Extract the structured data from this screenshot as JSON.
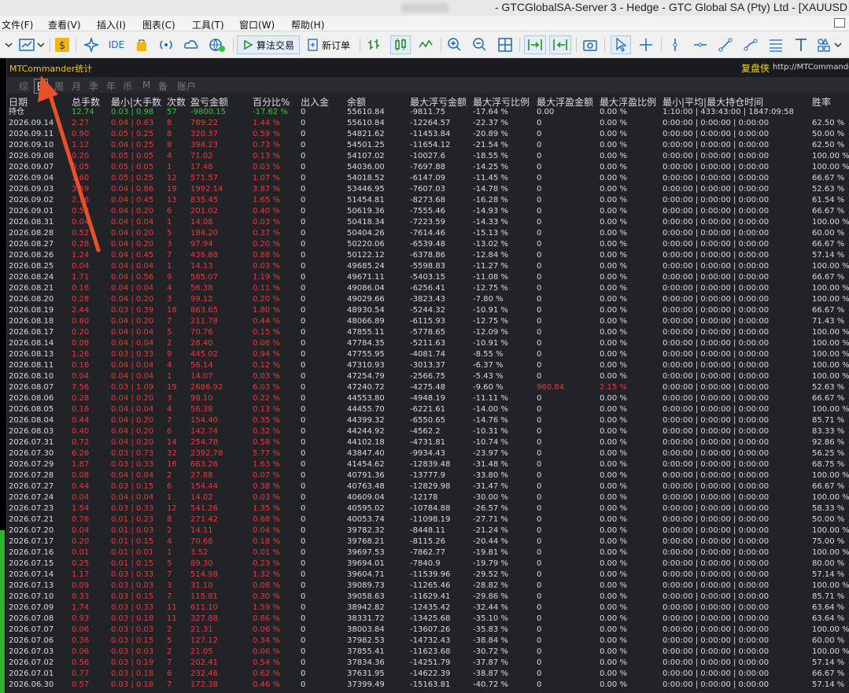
{
  "window": {
    "title": "- GTCGlobalSA-Server 3 - Hedge - GTC Global SA (Pty) Ltd - [XAUUSD"
  },
  "menu": [
    "文件(F)",
    "查看(V)",
    "插入(I)",
    "图表(C)",
    "工具(T)",
    "窗口(W)",
    "帮助(H)"
  ],
  "toolbar": {
    "ide": "IDE",
    "algo": "算法交易",
    "new_order": "新订单"
  },
  "panel": {
    "name": "MTCommander统计",
    "brand": "复盘侠",
    "url": "http://MTCommander"
  },
  "tabs": [
    "综",
    "日",
    "周",
    "月",
    "季",
    "年",
    "币",
    "M",
    "备",
    "账户"
  ],
  "active_tab": "日",
  "columns": [
    "日期",
    "总手数",
    "最小|大手数",
    "次数",
    "盈亏金额",
    "百分比%",
    "出入金",
    "余额",
    "最大浮亏金额",
    "最大浮亏比例",
    "最大浮盈金额",
    "最大浮盈比例",
    "最小|平均|最大持仓时间",
    "胜率"
  ],
  "positions_row": [
    "持仓",
    "12.74",
    "0.03 | 0.98",
    "57",
    "-9800.15",
    "-17.62 %",
    "0",
    "55610.84",
    "-9811.75",
    "-17.64 %",
    "0.00",
    "0.00 %",
    "1:10:00 | 433:43:00 | 1847:09:58",
    ""
  ],
  "rows": [
    [
      "2026.09.14",
      "2.27",
      "0.04 | 0.63",
      "8",
      "789.22",
      "1.44 %",
      "0",
      "55610.84",
      "-12264.57",
      "-22.37 %",
      "0",
      "0.00 %",
      "0:00:00 | 0:00:00 | 0:00:00",
      "62.50 %"
    ],
    [
      "2026.09.11",
      "0.90",
      "0.05 | 0.25",
      "8",
      "320.37",
      "0.59 %",
      "0",
      "54821.62",
      "-11453.84",
      "-20.89 %",
      "0",
      "0.00 %",
      "0:00:00 | 0:00:00 | 0:00:00",
      "50.00 %"
    ],
    [
      "2026.09.10",
      "1.12",
      "0.04 | 0.25",
      "8",
      "394.23",
      "0.73 %",
      "0",
      "54501.25",
      "-11654.12",
      "-21.54 %",
      "0",
      "0.00 %",
      "0:00:00 | 0:00:00 | 0:00:00",
      "62.50 %"
    ],
    [
      "2026.09.08",
      "0.20",
      "0.05 | 0.05",
      "4",
      "71.02",
      "0.13 %",
      "0",
      "54107.02",
      "-10027.6",
      "-18.55 %",
      "0",
      "0.00 %",
      "0:00:00 | 0:00:00 | 0:00:00",
      "100.00 %"
    ],
    [
      "2026.09.07",
      "0.05",
      "0.05 | 0.05",
      "1",
      "17.48",
      "0.03 %",
      "0",
      "54036.00",
      "-7697.88",
      "-14.25 %",
      "0",
      "0.00 %",
      "0:00:00 | 0:00:00 | 0:00:00",
      "100.00 %"
    ],
    [
      "2026.09.04",
      "1.60",
      "0.05 | 0.25",
      "12",
      "571.57",
      "1.07 %",
      "0",
      "54018.52",
      "-6147.09",
      "-11.45 %",
      "0",
      "0.00 %",
      "0:00:00 | 0:00:00 | 0:00:00",
      "66.67 %"
    ],
    [
      "2026.09.03",
      "3.59",
      "0.04 | 0.86",
      "19",
      "1992.14",
      "3.87 %",
      "0",
      "53446.95",
      "-7607.03",
      "-14.78 %",
      "0",
      "0.00 %",
      "0:00:00 | 0:00:00 | 0:00:00",
      "52.63 %"
    ],
    [
      "2026.09.02",
      "2.36",
      "0.04 | 0.45",
      "13",
      "835.45",
      "1.65 %",
      "0",
      "51454.81",
      "-8273.68",
      "-16.28 %",
      "0",
      "0.00 %",
      "0:00:00 | 0:00:00 | 0:00:00",
      "61.54 %"
    ],
    [
      "2026.09.01",
      "0.58",
      "0.04 | 0.20",
      "6",
      "201.02",
      "0.40 %",
      "0",
      "50619.36",
      "-7555.46",
      "-14.93 %",
      "0",
      "0.00 %",
      "0:00:00 | 0:00:00 | 0:00:00",
      "66.67 %"
    ],
    [
      "2026.08.31",
      "0.04",
      "0.04 | 0.04",
      "1",
      "14.08",
      "0.03 %",
      "0",
      "50418.34",
      "-7223.59",
      "-14.33 %",
      "0",
      "0.00 %",
      "0:00:00 | 0:00:00 | 0:00:00",
      "100.00 %"
    ],
    [
      "2026.08.28",
      "0.52",
      "0.04 | 0.20",
      "5",
      "184.20",
      "0.37 %",
      "0",
      "50404.26",
      "-7614.46",
      "-15.13 %",
      "0",
      "0.00 %",
      "0:00:00 | 0:00:00 | 0:00:00",
      "60.00 %"
    ],
    [
      "2026.08.27",
      "0.28",
      "0.04 | 0.20",
      "3",
      "97.94",
      "0.20 %",
      "0",
      "50220.06",
      "-6539.48",
      "-13.02 %",
      "0",
      "0.00 %",
      "0:00:00 | 0:00:00 | 0:00:00",
      "66.67 %"
    ],
    [
      "2026.08.26",
      "1.24",
      "0.04 | 0.45",
      "7",
      "436.88",
      "0.88 %",
      "0",
      "50122.12",
      "-6378.86",
      "-12.84 %",
      "0",
      "0.00 %",
      "0:00:00 | 0:00:00 | 0:00:00",
      "57.14 %"
    ],
    [
      "2026.08.25",
      "0.04",
      "0.04 | 0.04",
      "1",
      "14.13",
      "0.03 %",
      "0",
      "49685.24",
      "-5598.83",
      "-11.27 %",
      "0",
      "0.00 %",
      "0:00:00 | 0:00:00 | 0:00:00",
      "100.00 %"
    ],
    [
      "2026.08.24",
      "1.71",
      "0.04 | 0.56",
      "9",
      "585.07",
      "1.19 %",
      "0",
      "49671.11",
      "-5403.15",
      "-11.08 %",
      "0",
      "0.00 %",
      "0:00:00 | 0:00:00 | 0:00:00",
      "66.67 %"
    ],
    [
      "2026.08.21",
      "0.16",
      "0.04 | 0.04",
      "4",
      "56.38",
      "0.11 %",
      "0",
      "49086.04",
      "-6256.41",
      "-12.75 %",
      "0",
      "0.00 %",
      "0:00:00 | 0:00:00 | 0:00:00",
      "100.00 %"
    ],
    [
      "2026.08.20",
      "0.28",
      "0.04 | 0.20",
      "3",
      "99.12",
      "0.20 %",
      "0",
      "49029.66",
      "-3823.43",
      "-7.80 %",
      "0",
      "0.00 %",
      "0:00:00 | 0:00:00 | 0:00:00",
      "100.00 %"
    ],
    [
      "2026.08.19",
      "2.44",
      "0.03 | 0.39",
      "18",
      "863.65",
      "1.80 %",
      "0",
      "48930.54",
      "-5244.32",
      "-10.91 %",
      "0",
      "0.00 %",
      "0:00:00 | 0:00:00 | 0:00:00",
      "66.67 %"
    ],
    [
      "2026.08.18",
      "0.60",
      "0.04 | 0.20",
      "7",
      "211.78",
      "0.44 %",
      "0",
      "48066.89",
      "-6115.93",
      "-12.75 %",
      "0",
      "0.00 %",
      "0:00:00 | 0:00:00 | 0:00:00",
      "71.43 %"
    ],
    [
      "2026.08.17",
      "0.20",
      "0.04 | 0.04",
      "5",
      "70.76",
      "0.15 %",
      "0",
      "47855.11",
      "-5778.65",
      "-12.09 %",
      "0",
      "0.00 %",
      "0:00:00 | 0:00:00 | 0:00:00",
      "100.00 %"
    ],
    [
      "2026.08.14",
      "0.08",
      "0.04 | 0.04",
      "2",
      "28.40",
      "0.06 %",
      "0",
      "47784.35",
      "-5211.63",
      "-10.91 %",
      "0",
      "0.00 %",
      "0:00:00 | 0:00:00 | 0:00:00",
      "100.00 %"
    ],
    [
      "2026.08.13",
      "1.26",
      "0.03 | 0.33",
      "9",
      "445.02",
      "0.94 %",
      "0",
      "47755.95",
      "-4081.74",
      "-8.55 %",
      "0",
      "0.00 %",
      "0:00:00 | 0:00:00 | 0:00:00",
      "100.00 %"
    ],
    [
      "2026.08.11",
      "0.16",
      "0.04 | 0.04",
      "4",
      "56.14",
      "0.12 %",
      "0",
      "47310.93",
      "-3013.37",
      "-6.37 %",
      "0",
      "0.00 %",
      "0:00:00 | 0:00:00 | 0:00:00",
      "100.00 %"
    ],
    [
      "2026.08.10",
      "0.04",
      "0.04 | 0.04",
      "1",
      "14.07",
      "0.03 %",
      "0",
      "47254.79",
      "-2566.75",
      "-5.43 %",
      "0",
      "0.00 %",
      "0:00:00 | 0:00:00 | 0:00:00",
      "100.00 %"
    ],
    [
      "2026.08.07",
      "7.56",
      "0.03 | 1.09",
      "19",
      "2686.92",
      "6.03 %",
      "0",
      "47240.72",
      "-4275.48",
      "-9.60 %",
      "960.84",
      "2.15 %",
      "0:00:00 | 0:00:00 | 0:00:00",
      "52.63 %"
    ],
    [
      "2026.08.06",
      "0.28",
      "0.04 | 0.20",
      "3",
      "98.10",
      "0.22 %",
      "0",
      "44553.80",
      "-4948.19",
      "-11.11 %",
      "0",
      "0.00 %",
      "0:00:00 | 0:00:00 | 0:00:00",
      "66.67 %"
    ],
    [
      "2026.08.05",
      "0.16",
      "0.04 | 0.04",
      "4",
      "56.38",
      "0.13 %",
      "0",
      "44455.70",
      "-6221.61",
      "-14.00 %",
      "0",
      "0.00 %",
      "0:00:00 | 0:00:00 | 0:00:00",
      "100.00 %"
    ],
    [
      "2026.08.04",
      "0.44",
      "0.04 | 0.20",
      "7",
      "154.40",
      "0.35 %",
      "0",
      "44399.32",
      "-6550.65",
      "-14.76 %",
      "0",
      "0.00 %",
      "0:00:00 | 0:00:00 | 0:00:00",
      "85.71 %"
    ],
    [
      "2026.08.03",
      "0.40",
      "0.04 | 0.20",
      "6",
      "142.74",
      "0.32 %",
      "0",
      "44244.92",
      "-4562.2",
      "-10.31 %",
      "0",
      "0.00 %",
      "0:00:00 | 0:00:00 | 0:00:00",
      "83.33 %"
    ],
    [
      "2026.07.31",
      "0.72",
      "0.04 | 0.20",
      "14",
      "254.78",
      "0.58 %",
      "0",
      "44102.18",
      "-4731.81",
      "-10.74 %",
      "0",
      "0.00 %",
      "0:00:00 | 0:00:00 | 0:00:00",
      "92.86 %"
    ],
    [
      "2026.07.30",
      "6.26",
      "0.03 | 0.73",
      "32",
      "2392.78",
      "5.77 %",
      "0",
      "43847.40",
      "-9934.43",
      "-23.97 %",
      "0",
      "0.00 %",
      "0:00:00 | 0:00:00 | 0:00:00",
      "56.25 %"
    ],
    [
      "2026.07.29",
      "1.87",
      "0.03 | 0.33",
      "16",
      "663.26",
      "1.63 %",
      "0",
      "41454.62",
      "-12839.48",
      "-31.48 %",
      "0",
      "0.00 %",
      "0:00:00 | 0:00:00 | 0:00:00",
      "68.75 %"
    ],
    [
      "2026.07.28",
      "0.08",
      "0.04 | 0.04",
      "2",
      "27.88",
      "0.07 %",
      "0",
      "40791.36",
      "-13777.9",
      "-33.80 %",
      "0",
      "0.00 %",
      "0:00:00 | 0:00:00 | 0:00:00",
      "100.00 %"
    ],
    [
      "2026.07.27",
      "0.44",
      "0.03 | 0.15",
      "6",
      "154.44",
      "0.38 %",
      "0",
      "40763.48",
      "-12829.98",
      "-31.47 %",
      "0",
      "0.00 %",
      "0:00:00 | 0:00:00 | 0:00:00",
      "66.67 %"
    ],
    [
      "2026.07.24",
      "0.04",
      "0.04 | 0.04",
      "1",
      "14.02",
      "0.03 %",
      "0",
      "40609.04",
      "-12178",
      "-30.00 %",
      "0",
      "0.00 %",
      "0:00:00 | 0:00:00 | 0:00:00",
      "100.00 %"
    ],
    [
      "2026.07.23",
      "1.54",
      "0.03 | 0.33",
      "12",
      "541.26",
      "1.35 %",
      "0",
      "40595.02",
      "-10784.88",
      "-26.57 %",
      "0",
      "0.00 %",
      "0:00:00 | 0:00:00 | 0:00:00",
      "58.33 %"
    ],
    [
      "2026.07.21",
      "0.76",
      "0.01 | 0.23",
      "8",
      "271.42",
      "0.68 %",
      "0",
      "40053.74",
      "-11098.19",
      "-27.71 %",
      "0",
      "0.00 %",
      "0:00:00 | 0:00:00 | 0:00:00",
      "50.00 %"
    ],
    [
      "2026.07.20",
      "0.04",
      "0.01 | 0.03",
      "2",
      "14.11",
      "0.04 %",
      "0",
      "39782.32",
      "-8448.11",
      "-21.24 %",
      "0",
      "0.00 %",
      "0:00:00 | 0:00:00 | 0:00:00",
      "100.00 %"
    ],
    [
      "2026.07.17",
      "0.20",
      "0.01 | 0.15",
      "4",
      "70.68",
      "0.18 %",
      "0",
      "39768.21",
      "-8115.26",
      "-20.44 %",
      "0",
      "0.00 %",
      "0:00:00 | 0:00:00 | 0:00:00",
      "75.00 %"
    ],
    [
      "2026.07.16",
      "0.01",
      "0.01 | 0.01",
      "1",
      "3.52",
      "0.01 %",
      "0",
      "39697.53",
      "-7862.77",
      "-19.81 %",
      "0",
      "0.00 %",
      "0:00:00 | 0:00:00 | 0:00:00",
      "100.00 %"
    ],
    [
      "2026.07.15",
      "0.25",
      "0.01 | 0.15",
      "5",
      "89.30",
      "0.23 %",
      "0",
      "39694.01",
      "-7840.9",
      "-19.79 %",
      "0",
      "0.00 %",
      "0:00:00 | 0:00:00 | 0:00:00",
      "80.00 %"
    ],
    [
      "2026.07.14",
      "1.17",
      "0.03 | 0.33",
      "7",
      "514.98",
      "1.32 %",
      "0",
      "39604.71",
      "-11539.96",
      "-29.52 %",
      "0",
      "0.00 %",
      "0:00:00 | 0:00:00 | 0:00:00",
      "57.14 %"
    ],
    [
      "2026.07.13",
      "0.09",
      "0.03 | 0.03",
      "3",
      "31.10",
      "0.08 %",
      "0",
      "39089.73",
      "-11265.46",
      "-28.82 %",
      "0",
      "0.00 %",
      "0:00:00 | 0:00:00 | 0:00:00",
      "100.00 %"
    ],
    [
      "2026.07.10",
      "0.33",
      "0.03 | 0.15",
      "7",
      "115.81",
      "0.30 %",
      "0",
      "39058.63",
      "-11629.41",
      "-29.86 %",
      "0",
      "0.00 %",
      "0:00:00 | 0:00:00 | 0:00:00",
      "85.71 %"
    ],
    [
      "2026.07.09",
      "1.74",
      "0.03 | 0.33",
      "11",
      "611.10",
      "1.59 %",
      "0",
      "38942.82",
      "-12435.42",
      "-32.44 %",
      "0",
      "0.00 %",
      "0:00:00 | 0:00:00 | 0:00:00",
      "63.64 %"
    ],
    [
      "2026.07.08",
      "0.93",
      "0.03 | 0.18",
      "11",
      "327.88",
      "0.86 %",
      "0",
      "38331.72",
      "-13425.68",
      "-35.10 %",
      "0",
      "0.00 %",
      "0:00:00 | 0:00:00 | 0:00:00",
      "63.64 %"
    ],
    [
      "2026.07.07",
      "0.06",
      "0.03 | 0.03",
      "2",
      "21.31",
      "0.06 %",
      "0",
      "38003.84",
      "-13607.26",
      "-35.83 %",
      "0",
      "0.00 %",
      "0:00:00 | 0:00:00 | 0:00:00",
      "100.00 %"
    ],
    [
      "2026.07.06",
      "0.36",
      "0.03 | 0.15",
      "5",
      "127.12",
      "0.34 %",
      "0",
      "37982.53",
      "-14732.43",
      "-38.84 %",
      "0",
      "0.00 %",
      "0:00:00 | 0:00:00 | 0:00:00",
      "60.00 %"
    ],
    [
      "2026.07.03",
      "0.06",
      "0.03 | 0.03",
      "2",
      "21.05",
      "0.06 %",
      "0",
      "37855.41",
      "-11623.68",
      "-30.72 %",
      "0",
      "0.00 %",
      "0:00:00 | 0:00:00 | 0:00:00",
      "100.00 %"
    ],
    [
      "2026.07.02",
      "0.56",
      "0.03 | 0.19",
      "7",
      "202.41",
      "0.54 %",
      "0",
      "37834.36",
      "-14251.79",
      "-37.87 %",
      "0",
      "0.00 %",
      "0:00:00 | 0:00:00 | 0:00:00",
      "57.14 %"
    ],
    [
      "2026.07.01",
      "0.77",
      "0.03 | 0.18",
      "6",
      "232.46",
      "0.62 %",
      "0",
      "37631.95",
      "-14622.39",
      "-38.87 %",
      "0",
      "0.00 %",
      "0:00:00 | 0:00:00 | 0:00:00",
      "66.67 %"
    ],
    [
      "2026.06.30",
      "0.57",
      "0.03 | 0.18",
      "7",
      "172.38",
      "0.46 %",
      "0",
      "37399.49",
      "-15163.81",
      "-40.72 %",
      "0",
      "0.00 %",
      "0:00:00 | 0:00:00 | 0:00:00",
      "57.14 %"
    ]
  ],
  "colors": {
    "loss": "#e33b3b",
    "profit": "#3cc23c",
    "text": "#dcdcdc",
    "annotation_arrow": "#e8502a"
  },
  "annotation": "arrow pointing to 日 tab"
}
